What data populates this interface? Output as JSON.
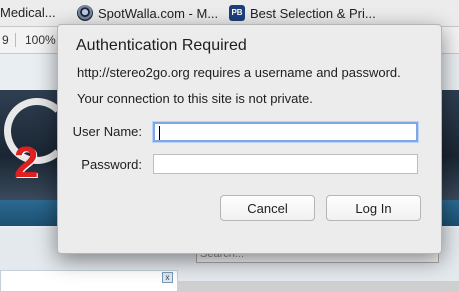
{
  "bookmarks": [
    {
      "label": "Medical...",
      "icon": "none"
    },
    {
      "label": "SpotWalla.com - M...",
      "icon": "spotwalla-icon"
    },
    {
      "label": "Best Selection & Pri...",
      "icon": "pb-icon",
      "icon_text": "PB"
    }
  ],
  "toolbar": {
    "left_num": "9",
    "zoom": "100%"
  },
  "site": {
    "search_placeholder": "Search..."
  },
  "dialog": {
    "title": "Authentication Required",
    "message": "http://stereo2go.org requires a username and password.",
    "warning": "Your connection to this site is not private.",
    "username_label": "User Name:",
    "password_label": "Password:",
    "username_value": "",
    "password_value": "",
    "cancel_label": "Cancel",
    "login_label": "Log In"
  },
  "colors": {
    "focus_ring": "#7fa7e6",
    "dialog_bg": "#ececec"
  }
}
